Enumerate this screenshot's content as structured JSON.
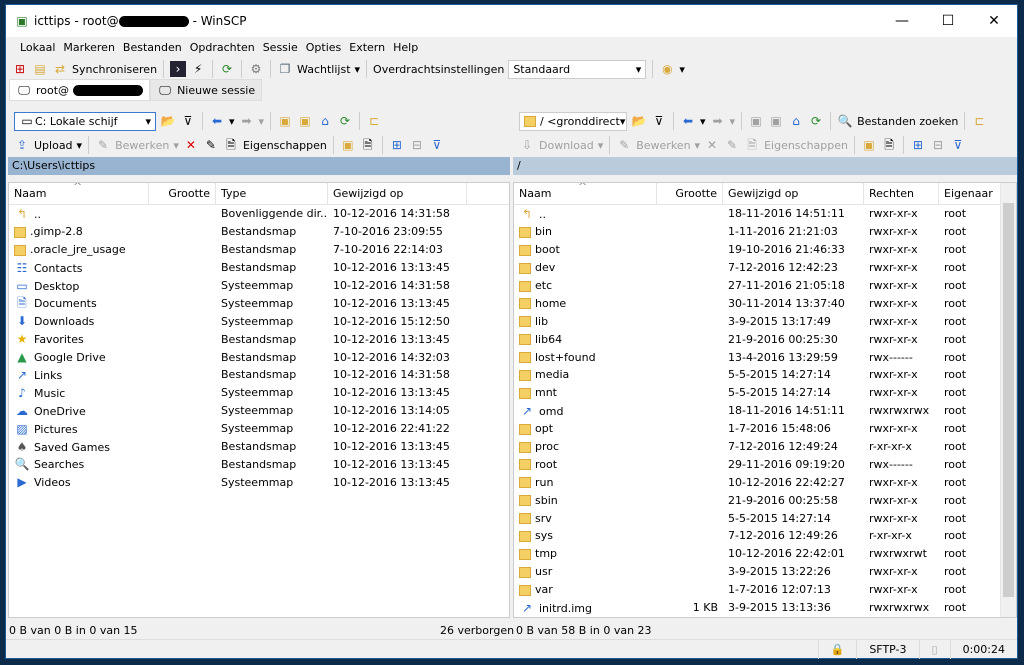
{
  "title": {
    "app": "icttips - root@",
    "suffix": "- WinSCP"
  },
  "menu": [
    "Lokaal",
    "Markeren",
    "Bestanden",
    "Opdrachten",
    "Sessie",
    "Opties",
    "Extern",
    "Help"
  ],
  "toolbar": {
    "sync": "Synchroniseren",
    "queue": "Wachtlijst",
    "transfer_label": "Overdrachtsinstellingen",
    "transfer_value": "Standaard"
  },
  "tabs": {
    "session": "root@",
    "new": "Nieuwe sessie"
  },
  "left": {
    "drive": "C: Lokale schijf",
    "upload": "Upload",
    "edit": "Bewerken",
    "props": "Eigenschappen",
    "path": "C:\\Users\\icttips",
    "columns": [
      "Naam",
      "Grootte",
      "Type",
      "Gewijzigd op"
    ],
    "rows": [
      [
        "..",
        "",
        "Bovenliggende dir...",
        "10-12-2016  14:31:58",
        "up-icon"
      ],
      [
        ".gimp-2.8",
        "",
        "Bestandsmap",
        "7-10-2016  23:09:55",
        "folder-icon"
      ],
      [
        ".oracle_jre_usage",
        "",
        "Bestandsmap",
        "7-10-2016  22:14:03",
        "folder-icon"
      ],
      [
        "Contacts",
        "",
        "Bestandsmap",
        "10-12-2016  13:13:45",
        "contacts-icon"
      ],
      [
        "Desktop",
        "",
        "Systeemmap",
        "10-12-2016  14:31:58",
        "desktop-icon"
      ],
      [
        "Documents",
        "",
        "Systeemmap",
        "10-12-2016  13:13:45",
        "documents-icon"
      ],
      [
        "Downloads",
        "",
        "Systeemmap",
        "10-12-2016  15:12:50",
        "downloads-icon"
      ],
      [
        "Favorites",
        "",
        "Bestandsmap",
        "10-12-2016  13:13:45",
        "star-icon"
      ],
      [
        "Google Drive",
        "",
        "Bestandsmap",
        "10-12-2016  14:32:03",
        "google-drive-icon"
      ],
      [
        "Links",
        "",
        "Bestandsmap",
        "10-12-2016  14:31:58",
        "links-icon"
      ],
      [
        "Music",
        "",
        "Systeemmap",
        "10-12-2016  13:13:45",
        "music-icon"
      ],
      [
        "OneDrive",
        "",
        "Systeemmap",
        "10-12-2016  13:14:05",
        "onedrive-icon"
      ],
      [
        "Pictures",
        "",
        "Systeemmap",
        "10-12-2016  22:41:22",
        "pictures-icon"
      ],
      [
        "Saved Games",
        "",
        "Bestandsmap",
        "10-12-2016  13:13:45",
        "games-icon"
      ],
      [
        "Searches",
        "",
        "Bestandsmap",
        "10-12-2016  13:13:45",
        "search-icon"
      ],
      [
        "Videos",
        "",
        "Systeemmap",
        "10-12-2016  13:13:45",
        "videos-icon"
      ]
    ],
    "status": "0 B van 0 B in 0 van 15",
    "hidden": "26 verborgen"
  },
  "right": {
    "path_combo": "/ <gronddirect",
    "find": "Bestanden zoeken",
    "download": "Download",
    "edit": "Bewerken",
    "props": "Eigenschappen",
    "path": "/",
    "columns": [
      "Naam",
      "Grootte",
      "Gewijzigd op",
      "Rechten",
      "Eigenaar"
    ],
    "rows": [
      [
        "..",
        "",
        "18-11-2016 14:51:11",
        "rwxr-xr-x",
        "root",
        "up-icon"
      ],
      [
        "bin",
        "",
        "1-11-2016 21:21:03",
        "rwxr-xr-x",
        "root",
        "folder-icon"
      ],
      [
        "boot",
        "",
        "19-10-2016 21:46:33",
        "rwxr-xr-x",
        "root",
        "folder-icon"
      ],
      [
        "dev",
        "",
        "7-12-2016 12:42:23",
        "rwxr-xr-x",
        "root",
        "folder-icon"
      ],
      [
        "etc",
        "",
        "27-11-2016 21:05:18",
        "rwxr-xr-x",
        "root",
        "folder-icon"
      ],
      [
        "home",
        "",
        "30-11-2014 13:37:40",
        "rwxr-xr-x",
        "root",
        "folder-icon"
      ],
      [
        "lib",
        "",
        "3-9-2015 13:17:49",
        "rwxr-xr-x",
        "root",
        "folder-icon"
      ],
      [
        "lib64",
        "",
        "21-9-2016 00:25:30",
        "rwxr-xr-x",
        "root",
        "folder-icon"
      ],
      [
        "lost+found",
        "",
        "13-4-2016 13:29:59",
        "rwx------",
        "root",
        "folder-icon"
      ],
      [
        "media",
        "",
        "5-5-2015 14:27:14",
        "rwxr-xr-x",
        "root",
        "folder-icon"
      ],
      [
        "mnt",
        "",
        "5-5-2015 14:27:14",
        "rwxr-xr-x",
        "root",
        "folder-icon"
      ],
      [
        "omd",
        "",
        "18-11-2016 14:51:11",
        "rwxrwxrwx",
        "root",
        "symlink-icon"
      ],
      [
        "opt",
        "",
        "1-7-2016 15:48:06",
        "rwxr-xr-x",
        "root",
        "folder-icon"
      ],
      [
        "proc",
        "",
        "7-12-2016 12:49:24",
        "r-xr-xr-x",
        "root",
        "folder-icon"
      ],
      [
        "root",
        "",
        "29-11-2016 09:19:20",
        "rwx------",
        "root",
        "folder-icon"
      ],
      [
        "run",
        "",
        "10-12-2016 22:42:27",
        "rwxr-xr-x",
        "root",
        "folder-icon"
      ],
      [
        "sbin",
        "",
        "21-9-2016 00:25:58",
        "rwxr-xr-x",
        "root",
        "folder-icon"
      ],
      [
        "srv",
        "",
        "5-5-2015 14:27:14",
        "rwxr-xr-x",
        "root",
        "folder-icon"
      ],
      [
        "sys",
        "",
        "7-12-2016 12:49:26",
        "r-xr-xr-x",
        "root",
        "folder-icon"
      ],
      [
        "tmp",
        "",
        "10-12-2016 22:42:01",
        "rwxrwxrwt",
        "root",
        "folder-icon"
      ],
      [
        "usr",
        "",
        "3-9-2015 13:22:26",
        "rwxr-xr-x",
        "root",
        "folder-icon"
      ],
      [
        "var",
        "",
        "1-7-2016 12:07:13",
        "rwxr-xr-x",
        "root",
        "folder-icon"
      ],
      [
        "initrd.img",
        "1 KB",
        "3-9-2015 13:13:36",
        "rwxrwxrwx",
        "root",
        "symlink-icon"
      ]
    ],
    "status": "0 B van 58 B in 0 van 23"
  },
  "statusbar": {
    "protocol": "SFTP-3",
    "time": "0:00:24"
  }
}
